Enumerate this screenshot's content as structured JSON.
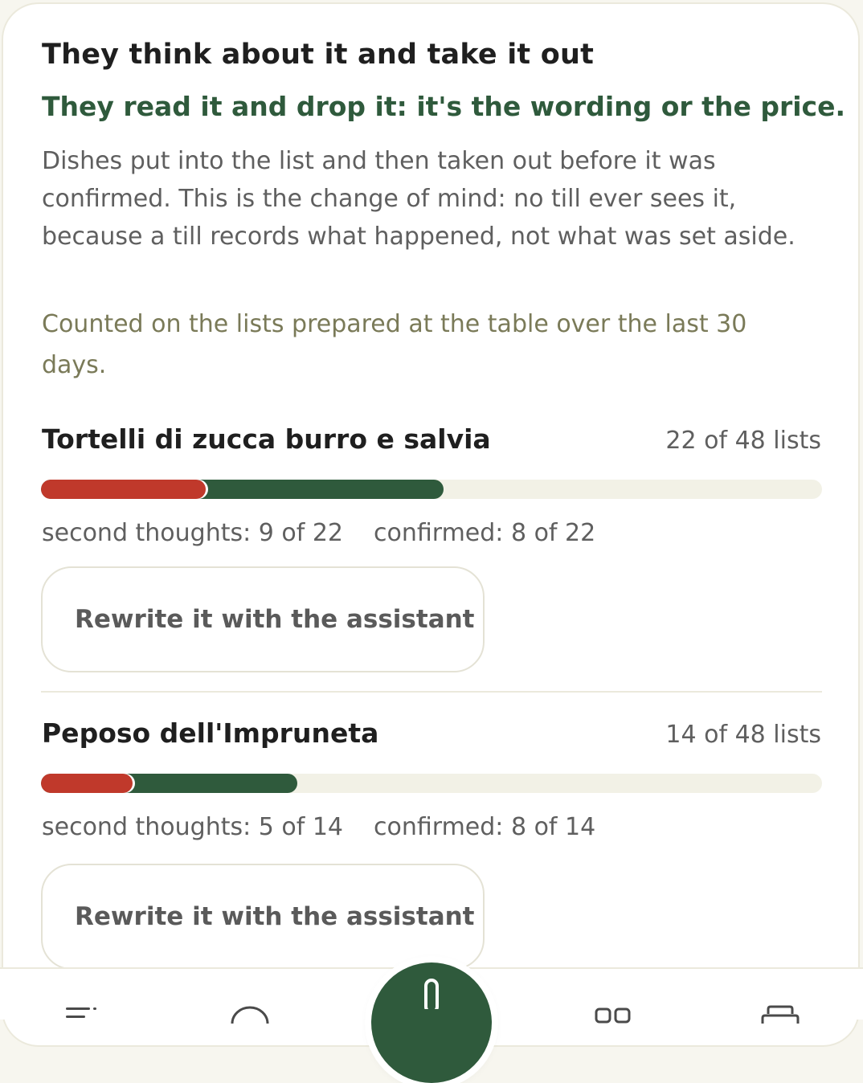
{
  "section": {
    "title": "They think about it and take it out",
    "subtitle": "They read it and drop it: it's the wording or the price.",
    "description": "Dishes put into the list and then taken out before it was confirmed. This is the change of mind: no till ever sees it, because a till records what happened, not what was set aside.",
    "note": "Counted on the lists prepared at the table over the last 30 days."
  },
  "dishes": [
    {
      "name": "Tortelli di zucca burro e salvia",
      "count_label": "22 of 48 lists",
      "added": 22,
      "total": 48,
      "second_thoughts": 9,
      "confirmed": 8,
      "second_thoughts_label": "second thoughts: 9 of 22",
      "confirmed_label": "confirmed: 8 of 22",
      "button_label": "Rewrite it with the assistant"
    },
    {
      "name": "Peposo dell'Impruneta",
      "count_label": "14 of 48 lists",
      "added": 14,
      "total": 48,
      "second_thoughts": 5,
      "confirmed": 8,
      "second_thoughts_label": "second thoughts: 5 of 14",
      "confirmed_label": "confirmed: 8 of 14",
      "button_label": "Rewrite it with the assistant"
    }
  ],
  "colors": {
    "accent_green": "#2f5a3c",
    "second_thoughts_red": "#c0392b",
    "track": "#f2f1e6"
  },
  "nav": {
    "icons": [
      "menu-icon",
      "chat-icon",
      "microphone-icon",
      "grid-icon",
      "printer-icon"
    ]
  }
}
